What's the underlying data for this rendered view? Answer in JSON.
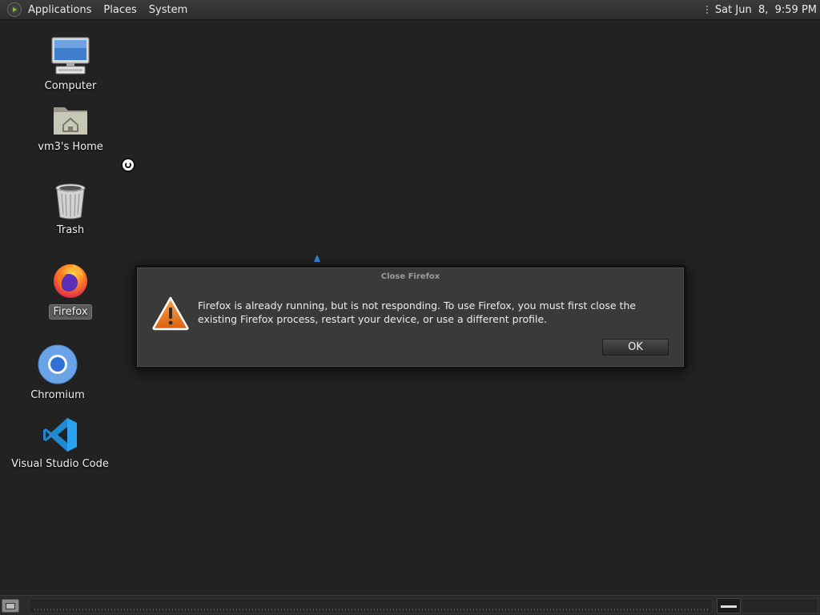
{
  "top_panel": {
    "menus": [
      "Applications",
      "Places",
      "System"
    ],
    "clock": "Sat Jun  8,  9:59 PM"
  },
  "desktop_icons": [
    {
      "label": "Computer",
      "icon": "computer-icon"
    },
    {
      "label": "vm3's Home",
      "icon": "home-folder-icon"
    },
    {
      "label": "Trash",
      "icon": "trash-icon"
    },
    {
      "label": "Firefox",
      "icon": "firefox-icon",
      "selected": true
    },
    {
      "label": "Chromium",
      "icon": "chromium-icon"
    },
    {
      "label": "Visual Studio Code",
      "icon": "vscode-icon"
    }
  ],
  "dialog": {
    "title": "Close Firefox",
    "message": "Firefox is already running, but is not responding. To use Firefox, you must first close the existing Firefox process, restart your device, or use a different profile.",
    "ok_label": "OK",
    "icon": "warning-icon"
  },
  "colors": {
    "desktop_bg": "#222222",
    "dialog_bg": "#3a3a3a",
    "warning_orange": "#e8741a"
  }
}
